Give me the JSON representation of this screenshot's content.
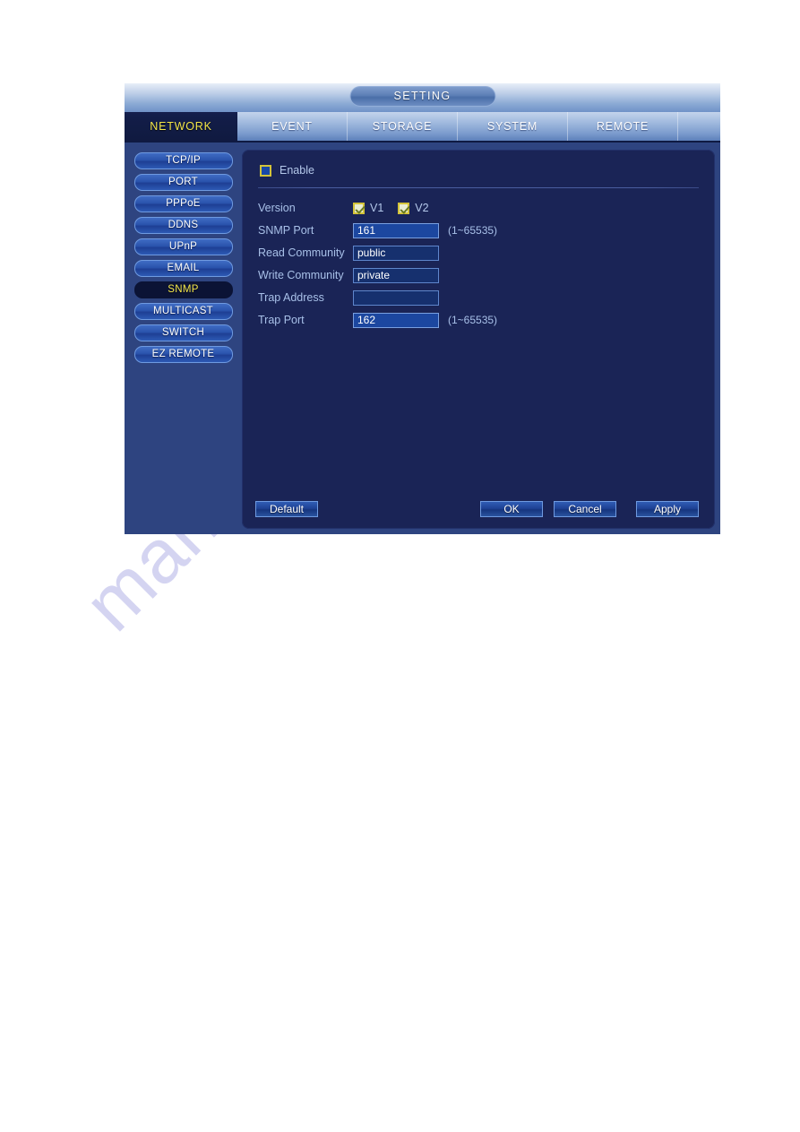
{
  "window": {
    "title": "SETTING"
  },
  "tabs": [
    {
      "label": "NETWORK",
      "active": true
    },
    {
      "label": "EVENT",
      "active": false
    },
    {
      "label": "STORAGE",
      "active": false
    },
    {
      "label": "SYSTEM",
      "active": false
    },
    {
      "label": "REMOTE",
      "active": false
    }
  ],
  "sidebar": {
    "items": [
      {
        "label": "TCP/IP",
        "active": false
      },
      {
        "label": "PORT",
        "active": false
      },
      {
        "label": "PPPoE",
        "active": false
      },
      {
        "label": "DDNS",
        "active": false
      },
      {
        "label": "UPnP",
        "active": false
      },
      {
        "label": "EMAIL",
        "active": false
      },
      {
        "label": "SNMP",
        "active": true
      },
      {
        "label": "MULTICAST",
        "active": false
      },
      {
        "label": "SWITCH",
        "active": false
      },
      {
        "label": "EZ REMOTE",
        "active": false
      }
    ]
  },
  "form": {
    "enable": {
      "label": "Enable",
      "checked": false
    },
    "version": {
      "label": "Version",
      "v1_label": "V1",
      "v1_checked": true,
      "v2_label": "V2",
      "v2_checked": true
    },
    "snmp_port": {
      "label": "SNMP Port",
      "value": "161",
      "hint": "(1~65535)"
    },
    "read_community": {
      "label": "Read Community",
      "value": "public",
      "hint": ""
    },
    "write_community": {
      "label": "Write Community",
      "value": "private",
      "hint": ""
    },
    "trap_address": {
      "label": "Trap Address",
      "value": "",
      "hint": ""
    },
    "trap_port": {
      "label": "Trap Port",
      "value": "162",
      "hint": "(1~65535)"
    }
  },
  "footer": {
    "default_label": "Default",
    "ok_label": "OK",
    "cancel_label": "Cancel",
    "apply_label": "Apply"
  },
  "watermark": {
    "text": "manualshive.com"
  },
  "colors": {
    "accent_yellow": "#f3e64a",
    "panel_navy": "#1a2456",
    "sidebar_blue": "#2e4480",
    "label_blue": "#a8c0e8",
    "checkbox_border": "#d3c33a"
  }
}
